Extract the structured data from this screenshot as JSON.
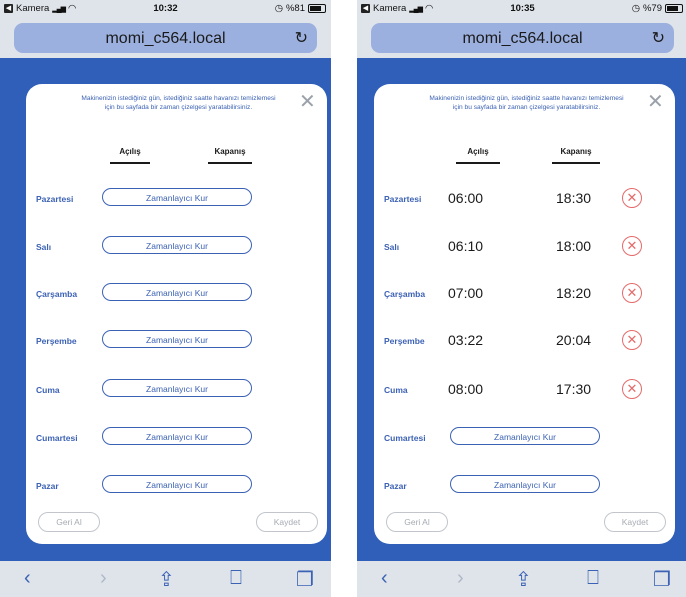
{
  "left": {
    "status": {
      "carrier": "Kamera",
      "time": "10:32",
      "battery": "%81",
      "battery_level": 0.81
    },
    "url": "momi_c564.local",
    "intro": "Makinenizin istediğiniz gün, istediğiniz saatte havanızı temizlemesi için bu sayfada bir zaman çizelgesi yaratabilirsiniz.",
    "col_open": "Açılış",
    "col_close": "Kapanış",
    "days": [
      {
        "name": "Pazartesi",
        "button": "Zamanlayıcı Kur"
      },
      {
        "name": "Salı",
        "button": "Zamanlayıcı Kur"
      },
      {
        "name": "Çarşamba",
        "button": "Zamanlayıcı Kur"
      },
      {
        "name": "Perşembe",
        "button": "Zamanlayıcı Kur"
      },
      {
        "name": "Cuma",
        "button": "Zamanlayıcı Kur"
      },
      {
        "name": "Cumartesi",
        "button": "Zamanlayıcı Kur"
      },
      {
        "name": "Pazar",
        "button": "Zamanlayıcı Kur"
      }
    ],
    "undo": "Geri Al",
    "save": "Kaydet"
  },
  "right": {
    "status": {
      "carrier": "Kamera",
      "time": "10:35",
      "battery": "%79",
      "battery_level": 0.79
    },
    "url": "momi_c564.local",
    "intro": "Makinenizin istediğiniz gün, istediğiniz saatte havanızı temizlemesi için bu sayfada bir zaman çizelgesi yaratabilirsiniz.",
    "col_open": "Açılış",
    "col_close": "Kapanış",
    "days": [
      {
        "name": "Pazartesi",
        "open": "06:00",
        "close": "18:30"
      },
      {
        "name": "Salı",
        "open": "06:10",
        "close": "18:00"
      },
      {
        "name": "Çarşamba",
        "open": "07:00",
        "close": "18:20"
      },
      {
        "name": "Perşembe",
        "open": "03:22",
        "close": "20:04"
      },
      {
        "name": "Cuma",
        "open": "08:00",
        "close": "17:30"
      },
      {
        "name": "Cumartesi",
        "button": "Zamanlayıcı Kur"
      },
      {
        "name": "Pazar",
        "button": "Zamanlayıcı Kur"
      }
    ],
    "undo": "Geri Al",
    "save": "Kaydet"
  },
  "icons": {
    "reload": "reload-icon",
    "close": "close-icon",
    "delete": "delete-circle-icon",
    "back": "chevron-left-icon",
    "forward": "chevron-right-icon",
    "share": "share-icon",
    "bookmarks": "book-icon",
    "tabs": "tabs-icon"
  },
  "colors": {
    "accent": "#3c62b4",
    "background": "#2f5fb8",
    "delete": "#e56a6a"
  }
}
